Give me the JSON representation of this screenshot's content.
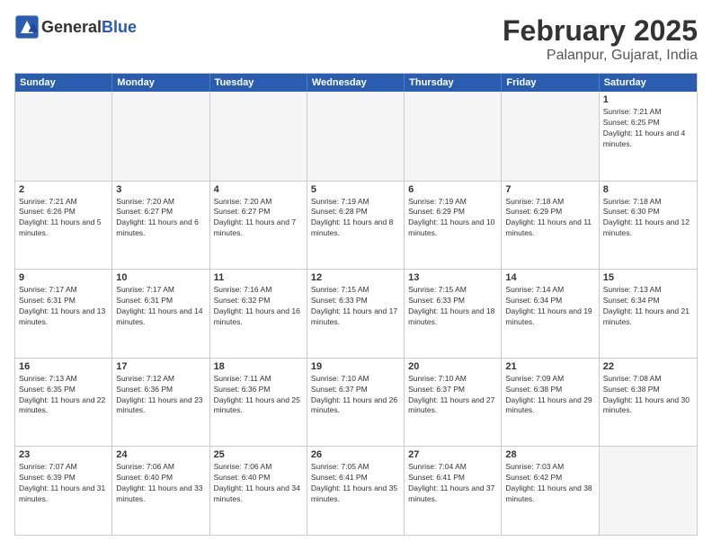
{
  "header": {
    "logo_general": "General",
    "logo_blue": "Blue",
    "month_title": "February 2025",
    "location": "Palanpur, Gujarat, India"
  },
  "weekdays": [
    "Sunday",
    "Monday",
    "Tuesday",
    "Wednesday",
    "Thursday",
    "Friday",
    "Saturday"
  ],
  "rows": [
    [
      {
        "day": "",
        "empty": true
      },
      {
        "day": "",
        "empty": true
      },
      {
        "day": "",
        "empty": true
      },
      {
        "day": "",
        "empty": true
      },
      {
        "day": "",
        "empty": true
      },
      {
        "day": "",
        "empty": true
      },
      {
        "day": "1",
        "sunrise": "7:21 AM",
        "sunset": "6:25 PM",
        "daylight": "11 hours and 4 minutes."
      }
    ],
    [
      {
        "day": "2",
        "sunrise": "7:21 AM",
        "sunset": "6:26 PM",
        "daylight": "11 hours and 5 minutes."
      },
      {
        "day": "3",
        "sunrise": "7:20 AM",
        "sunset": "6:27 PM",
        "daylight": "11 hours and 6 minutes."
      },
      {
        "day": "4",
        "sunrise": "7:20 AM",
        "sunset": "6:27 PM",
        "daylight": "11 hours and 7 minutes."
      },
      {
        "day": "5",
        "sunrise": "7:19 AM",
        "sunset": "6:28 PM",
        "daylight": "11 hours and 8 minutes."
      },
      {
        "day": "6",
        "sunrise": "7:19 AM",
        "sunset": "6:29 PM",
        "daylight": "11 hours and 10 minutes."
      },
      {
        "day": "7",
        "sunrise": "7:18 AM",
        "sunset": "6:29 PM",
        "daylight": "11 hours and 11 minutes."
      },
      {
        "day": "8",
        "sunrise": "7:18 AM",
        "sunset": "6:30 PM",
        "daylight": "11 hours and 12 minutes."
      }
    ],
    [
      {
        "day": "9",
        "sunrise": "7:17 AM",
        "sunset": "6:31 PM",
        "daylight": "11 hours and 13 minutes."
      },
      {
        "day": "10",
        "sunrise": "7:17 AM",
        "sunset": "6:31 PM",
        "daylight": "11 hours and 14 minutes."
      },
      {
        "day": "11",
        "sunrise": "7:16 AM",
        "sunset": "6:32 PM",
        "daylight": "11 hours and 16 minutes."
      },
      {
        "day": "12",
        "sunrise": "7:15 AM",
        "sunset": "6:33 PM",
        "daylight": "11 hours and 17 minutes."
      },
      {
        "day": "13",
        "sunrise": "7:15 AM",
        "sunset": "6:33 PM",
        "daylight": "11 hours and 18 minutes."
      },
      {
        "day": "14",
        "sunrise": "7:14 AM",
        "sunset": "6:34 PM",
        "daylight": "11 hours and 19 minutes."
      },
      {
        "day": "15",
        "sunrise": "7:13 AM",
        "sunset": "6:34 PM",
        "daylight": "11 hours and 21 minutes."
      }
    ],
    [
      {
        "day": "16",
        "sunrise": "7:13 AM",
        "sunset": "6:35 PM",
        "daylight": "11 hours and 22 minutes."
      },
      {
        "day": "17",
        "sunrise": "7:12 AM",
        "sunset": "6:36 PM",
        "daylight": "11 hours and 23 minutes."
      },
      {
        "day": "18",
        "sunrise": "7:11 AM",
        "sunset": "6:36 PM",
        "daylight": "11 hours and 25 minutes."
      },
      {
        "day": "19",
        "sunrise": "7:10 AM",
        "sunset": "6:37 PM",
        "daylight": "11 hours and 26 minutes."
      },
      {
        "day": "20",
        "sunrise": "7:10 AM",
        "sunset": "6:37 PM",
        "daylight": "11 hours and 27 minutes."
      },
      {
        "day": "21",
        "sunrise": "7:09 AM",
        "sunset": "6:38 PM",
        "daylight": "11 hours and 29 minutes."
      },
      {
        "day": "22",
        "sunrise": "7:08 AM",
        "sunset": "6:38 PM",
        "daylight": "11 hours and 30 minutes."
      }
    ],
    [
      {
        "day": "23",
        "sunrise": "7:07 AM",
        "sunset": "6:39 PM",
        "daylight": "11 hours and 31 minutes."
      },
      {
        "day": "24",
        "sunrise": "7:06 AM",
        "sunset": "6:40 PM",
        "daylight": "11 hours and 33 minutes."
      },
      {
        "day": "25",
        "sunrise": "7:06 AM",
        "sunset": "6:40 PM",
        "daylight": "11 hours and 34 minutes."
      },
      {
        "day": "26",
        "sunrise": "7:05 AM",
        "sunset": "6:41 PM",
        "daylight": "11 hours and 35 minutes."
      },
      {
        "day": "27",
        "sunrise": "7:04 AM",
        "sunset": "6:41 PM",
        "daylight": "11 hours and 37 minutes."
      },
      {
        "day": "28",
        "sunrise": "7:03 AM",
        "sunset": "6:42 PM",
        "daylight": "11 hours and 38 minutes."
      },
      {
        "day": "",
        "empty": true
      }
    ]
  ]
}
